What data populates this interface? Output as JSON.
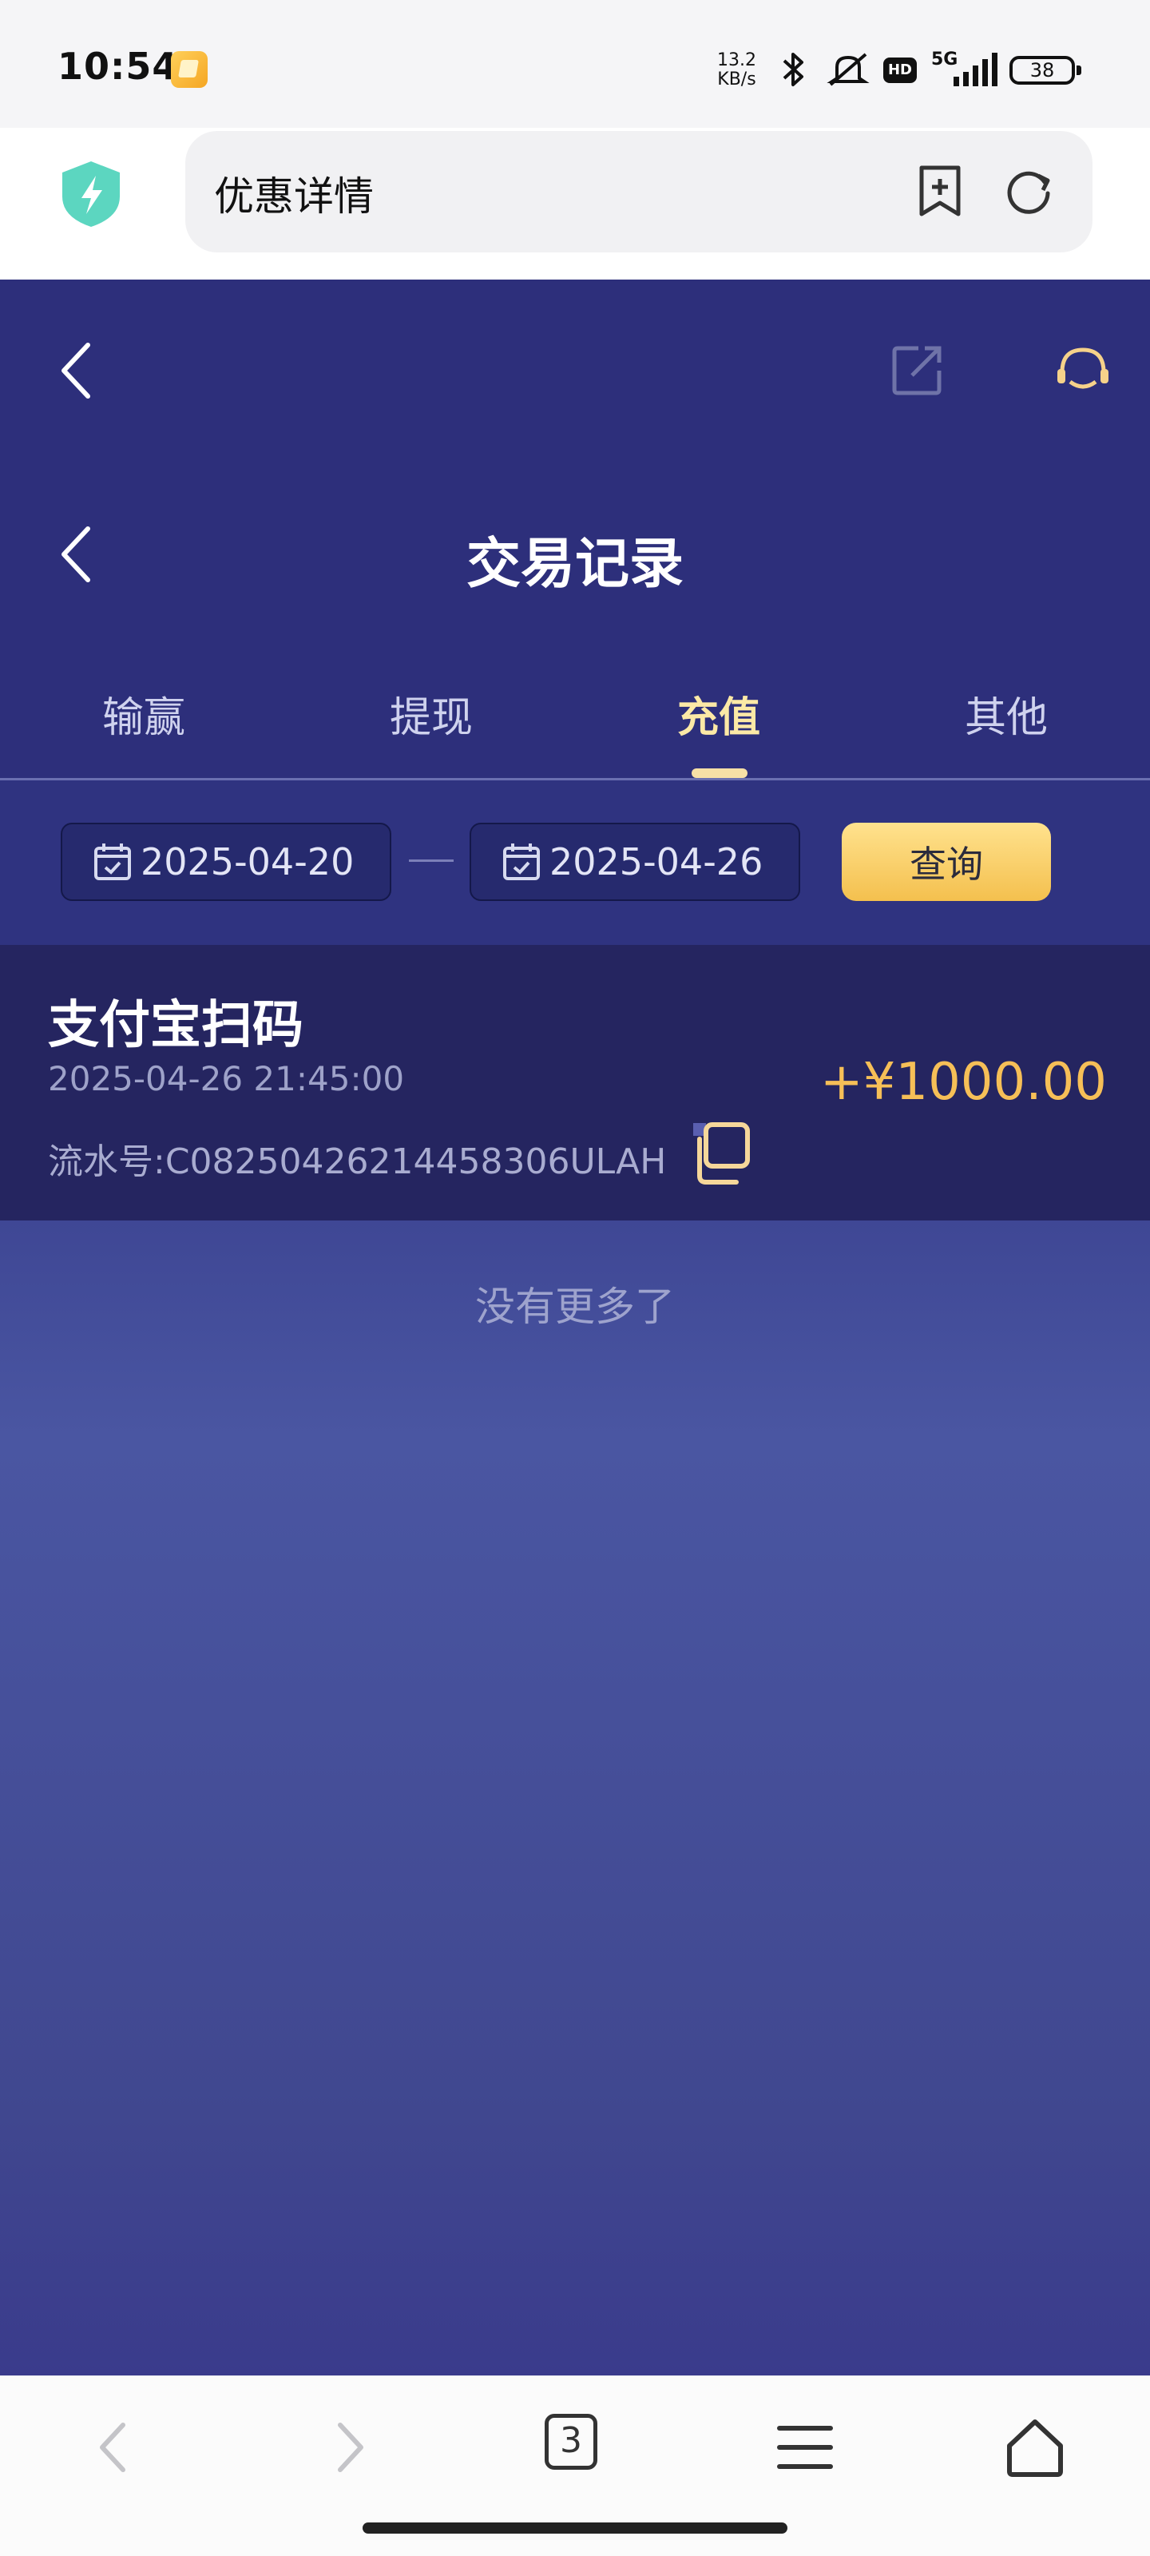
{
  "status_bar": {
    "time": "10:54",
    "net_speed_value": "13.2",
    "net_speed_unit": "KB/s",
    "hd_badge": "HD",
    "network": "5G",
    "battery": "38"
  },
  "browser": {
    "page_title": "优惠详情",
    "tab_count": "3"
  },
  "header": {
    "title": "交易记录"
  },
  "tabs": [
    {
      "label": "输赢",
      "active": false
    },
    {
      "label": "提现",
      "active": false
    },
    {
      "label": "充值",
      "active": true
    },
    {
      "label": "其他",
      "active": false
    }
  ],
  "filter": {
    "start_date": "2025-04-20",
    "end_date": "2025-04-26",
    "query_label": "查询"
  },
  "records": [
    {
      "title": "支付宝扫码",
      "time": "2025-04-26 21:45:00",
      "serial": "流水号:C08250426214458306ULAH",
      "amount": "+¥1000.00"
    }
  ],
  "footer_text": "没有更多了",
  "colors": {
    "header_bg": "#2d2f7b",
    "accent_gold": "#f6bf57",
    "active_tab": "#fce9a6"
  }
}
